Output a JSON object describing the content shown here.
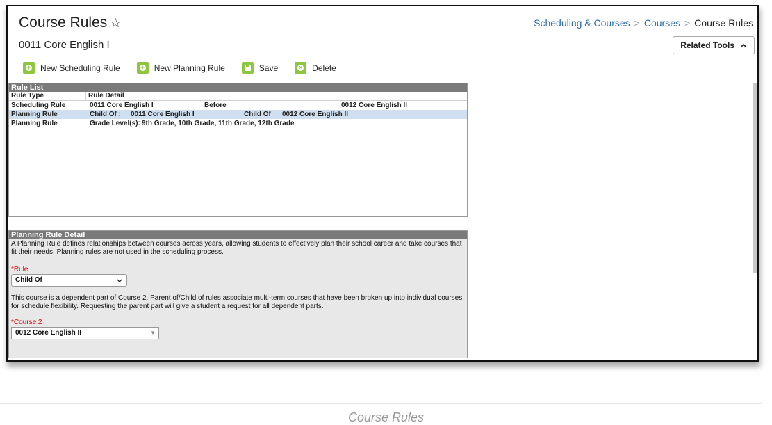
{
  "page": {
    "title": "Course Rules",
    "star": "☆",
    "course_name": "0011 Core English I"
  },
  "breadcrumb": {
    "item1": "Scheduling & Courses",
    "item2": "Courses",
    "current": "Course Rules",
    "separator": ">"
  },
  "related_tools": {
    "label": "Related Tools",
    "chevron": "^"
  },
  "toolbar": {
    "new_scheduling_rule": "New Scheduling Rule",
    "new_planning_rule": "New Planning Rule",
    "save": "Save",
    "delete": "Delete"
  },
  "rule_list": {
    "header": "Rule List",
    "col_type": "Rule Type",
    "col_detail": "Rule Detail",
    "rows": [
      {
        "type": "Scheduling Rule",
        "a": "0011 Core English I",
        "b": "Before",
        "c": "0012 Core English II"
      },
      {
        "type": "Planning Rule",
        "a": "Child Of :",
        "b": "0011 Core English I",
        "c": "Child Of",
        "d": "0012 Core English II"
      },
      {
        "type": "Planning Rule",
        "a": "Grade Level(s):",
        "b": "9th Grade, 10th Grade, 11th Grade, 12th Grade"
      }
    ]
  },
  "rule_detail": {
    "header": "Planning Rule Detail",
    "description": "A Planning Rule defines relationships between courses across years, allowing students to effectively plan their school career and take courses that fit their needs. Planning rules are not used in the scheduling process.",
    "rule_label": "*Rule",
    "rule_value": "Child Of",
    "rule_help": "This course is a dependent part of Course 2. Parent of/Child of rules associate multi-term courses that have been broken up into individual courses for schedule flexibility. Requesting the parent part will give a student a request for all dependent parts.",
    "course2_label": "*Course 2",
    "course2_value": "0012 Core English II"
  },
  "caption": "Course Rules",
  "colors": {
    "accent": "#8dc63f",
    "link": "#2b6cb0",
    "selected_row": "#cfdff0",
    "panel_header": "#7a7a7a",
    "required": "#dd0000"
  }
}
